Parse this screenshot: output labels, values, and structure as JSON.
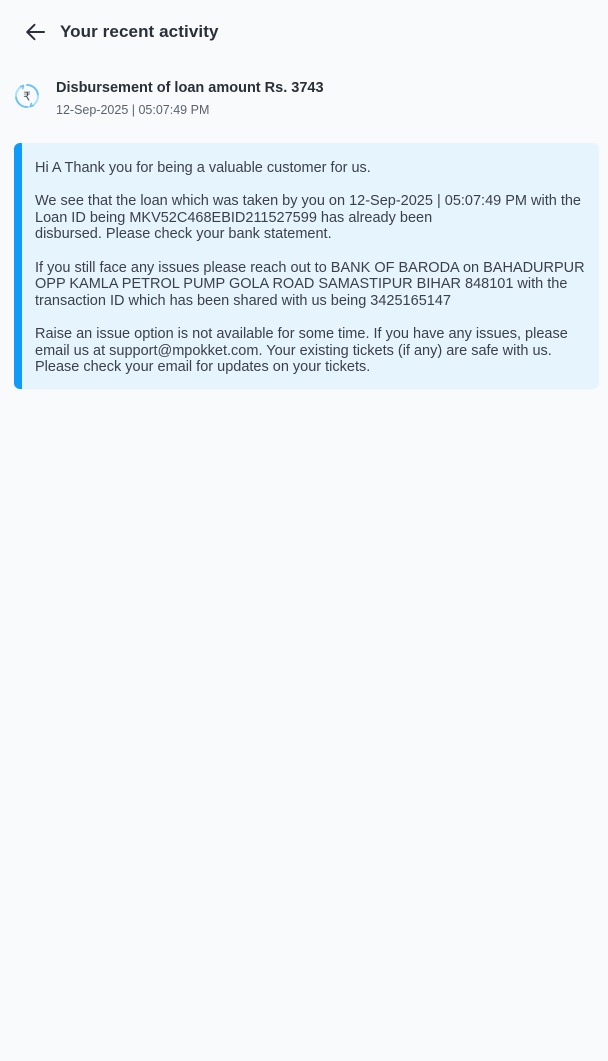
{
  "header": {
    "title": "Your recent activity"
  },
  "activity": {
    "icon": "rupee-refresh-icon",
    "title": "Disbursement of loan amount Rs. 3743",
    "timestamp": "12-Sep-2025 | 05:07:49 PM"
  },
  "message": {
    "paragraph_1": "Hi A Thank you for being a valuable customer for us.",
    "paragraph_2": "We see that the loan which was taken by you on 12-Sep-2025 | 05:07:49 PM with the\nLoan ID being MKV52C468EBID211527599 has already been\n disbursed. Please check your bank statement.",
    "paragraph_3": "If you still face any issues please reach out to BANK OF BARODA on BAHADURPUR\nOPP KAMLA PETROL PUMP GOLA ROAD SAMASTIPUR BIHAR 848101 with the\ntransaction ID which has been shared with us being 3425165147",
    "paragraph_4": "Raise an issue option is not available for some time. If you have any issues, please\nemail us at support@mpokket.com. Your existing tickets (if any) are safe with us.\nPlease check your email for updates on your tickets."
  },
  "colors": {
    "accent": "#0f9bf7",
    "card_background": "#e6f4fe",
    "page_background": "#f9fafb"
  }
}
